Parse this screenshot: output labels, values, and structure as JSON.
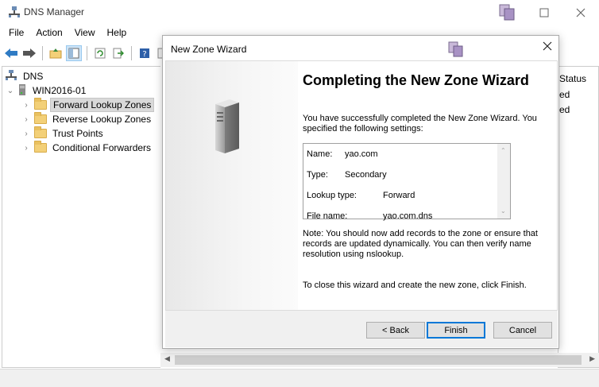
{
  "window": {
    "title": "DNS Manager"
  },
  "menu": [
    "File",
    "Action",
    "View",
    "Help"
  ],
  "tree": {
    "root": "DNS",
    "server": "WIN2016-01",
    "items": [
      "Forward Lookup Zones",
      "Reverse Lookup Zones",
      "Trust Points",
      "Conditional Forwarders"
    ],
    "selected": "Forward Lookup Zones"
  },
  "right_pane": {
    "column_header": "Status",
    "cells": [
      "ed",
      "ed"
    ]
  },
  "wizard": {
    "title": "New Zone Wizard",
    "heading": "Completing the New Zone Wizard",
    "intro": "You have successfully completed the New Zone Wizard. You specified the following settings:",
    "settings": [
      {
        "label": "Name:",
        "value": "yao.com"
      },
      {
        "label": "Type:",
        "value": "Secondary"
      },
      {
        "label": "Lookup type:",
        "value": "Forward"
      },
      {
        "label": "File name:",
        "value": "yao.com.dns"
      }
    ],
    "note": "Note: You should now add records to the zone or ensure that records are updated dynamically. You can then verify name resolution using nslookup.",
    "close_hint": "To close this wizard and create the new zone, click Finish.",
    "buttons": {
      "back": "< Back",
      "finish": "Finish",
      "cancel": "Cancel"
    }
  }
}
